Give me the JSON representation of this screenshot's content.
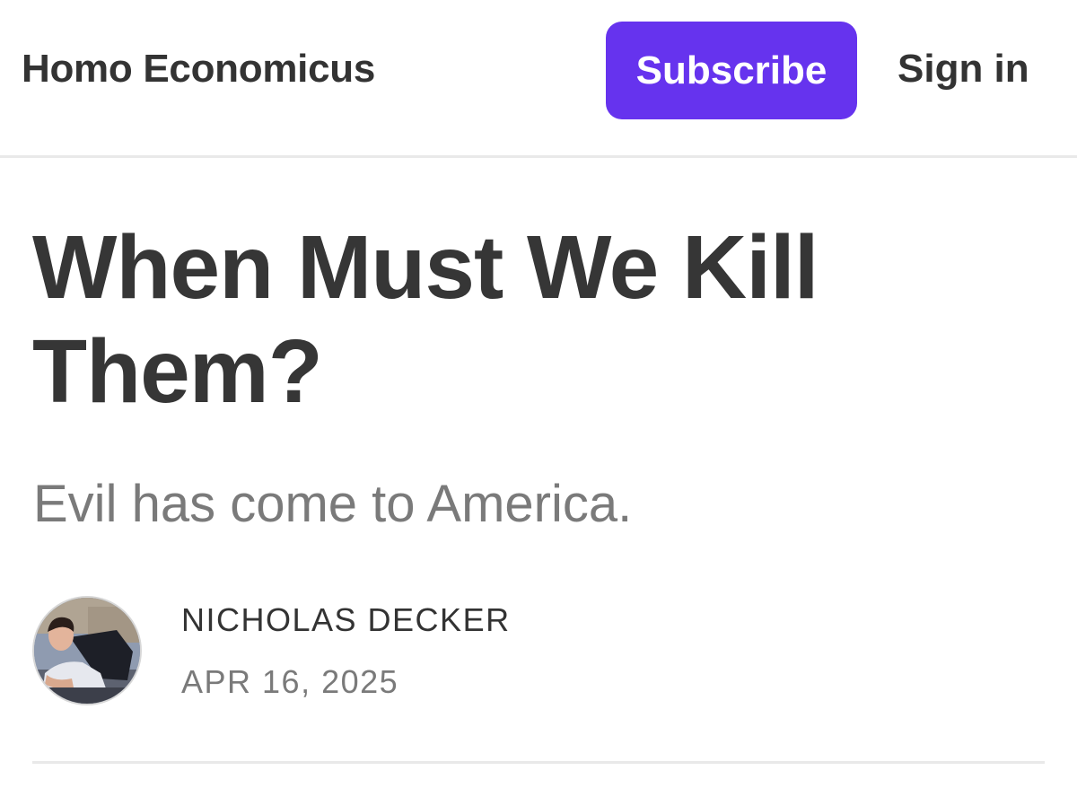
{
  "header": {
    "publication_name": "Homo Economicus",
    "subscribe_label": "Subscribe",
    "signin_label": "Sign in"
  },
  "post": {
    "title": "When Must We Kill Them?",
    "subtitle": "Evil has come to America.",
    "author": "NICHOLAS DECKER",
    "date": "APR 16, 2025"
  },
  "colors": {
    "accent": "#6633ee",
    "title_text": "#363636",
    "muted_text": "#7a7a7a",
    "divider": "#e9e9e9"
  }
}
